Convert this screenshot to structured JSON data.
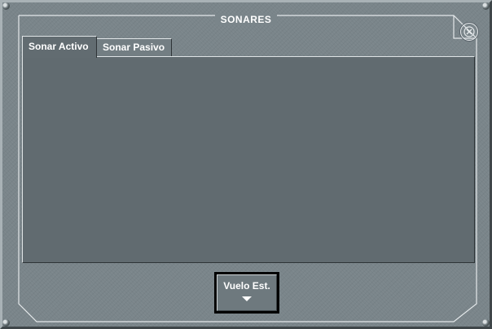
{
  "window": {
    "title": "SONARES"
  },
  "tabs": [
    {
      "label": "Sonar Activo",
      "active": true
    },
    {
      "label": "Sonar Pasivo",
      "active": false
    }
  ],
  "mode_button": {
    "label": "Vuelo Est."
  },
  "icons": {
    "close": "close-icon",
    "dropdown": "chevron-down-icon"
  },
  "colors": {
    "panel": "#616b70",
    "frame": "#7a858a",
    "text": "#ffffff"
  }
}
